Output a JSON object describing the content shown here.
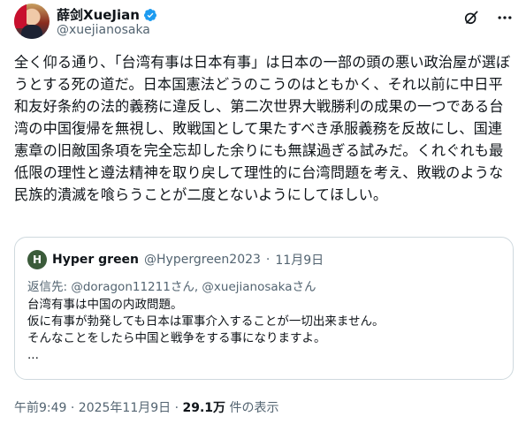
{
  "author": {
    "display_name": "薛剑XueJian",
    "handle": "@xuejianosaka"
  },
  "tweet_text": "全く仰る通り、「台湾有事は日本有事」は日本の一部の頭の悪い政治屋が選ぼうとする死の道だ。日本国憲法どうのこうのはともかく、それ以前に中日平和友好条約の法的義務に違反し、第二次世界大戦勝利の成果の一つである台湾の中国復帰を無視し、敗戦国として果たすべき承服義務を反故にし、国連憲章の旧敵国条項を完全忘却した余りにも無謀過ぎる試みだ。くれぐれも最低限の理性と遵法精神を取り戻して理性的に台湾問題を考え、敗戦のような民族的潰滅を喰らうことが二度とないようにしてほしい。",
  "quoted": {
    "avatar_letter": "H",
    "display_name": "Hyper green",
    "handle": "@Hypergreen2023",
    "separator": "·",
    "date": "11月9日",
    "reply_to": "返信先: @doragon11211さん, @xuejianosakaさん",
    "lines": [
      "台湾有事は中国の内政問題。",
      "仮に有事が勃発しても日本は軍事介入することが一切出来ません。",
      "そんなことをしたら中国と戦争をする事になりますよ。",
      "..."
    ]
  },
  "footer": {
    "time_date": "午前9:49 · 2025年11月9日 · ",
    "views_count": "29.1万",
    "views_label": " 件の表示"
  },
  "icons": {
    "verified": "verified-badge-icon",
    "grok": "grok-icon",
    "more": "more-options-icon"
  },
  "colors": {
    "verified_blue": "#1d9bf0",
    "secondary_text": "#536471",
    "border": "#cfd9de"
  }
}
